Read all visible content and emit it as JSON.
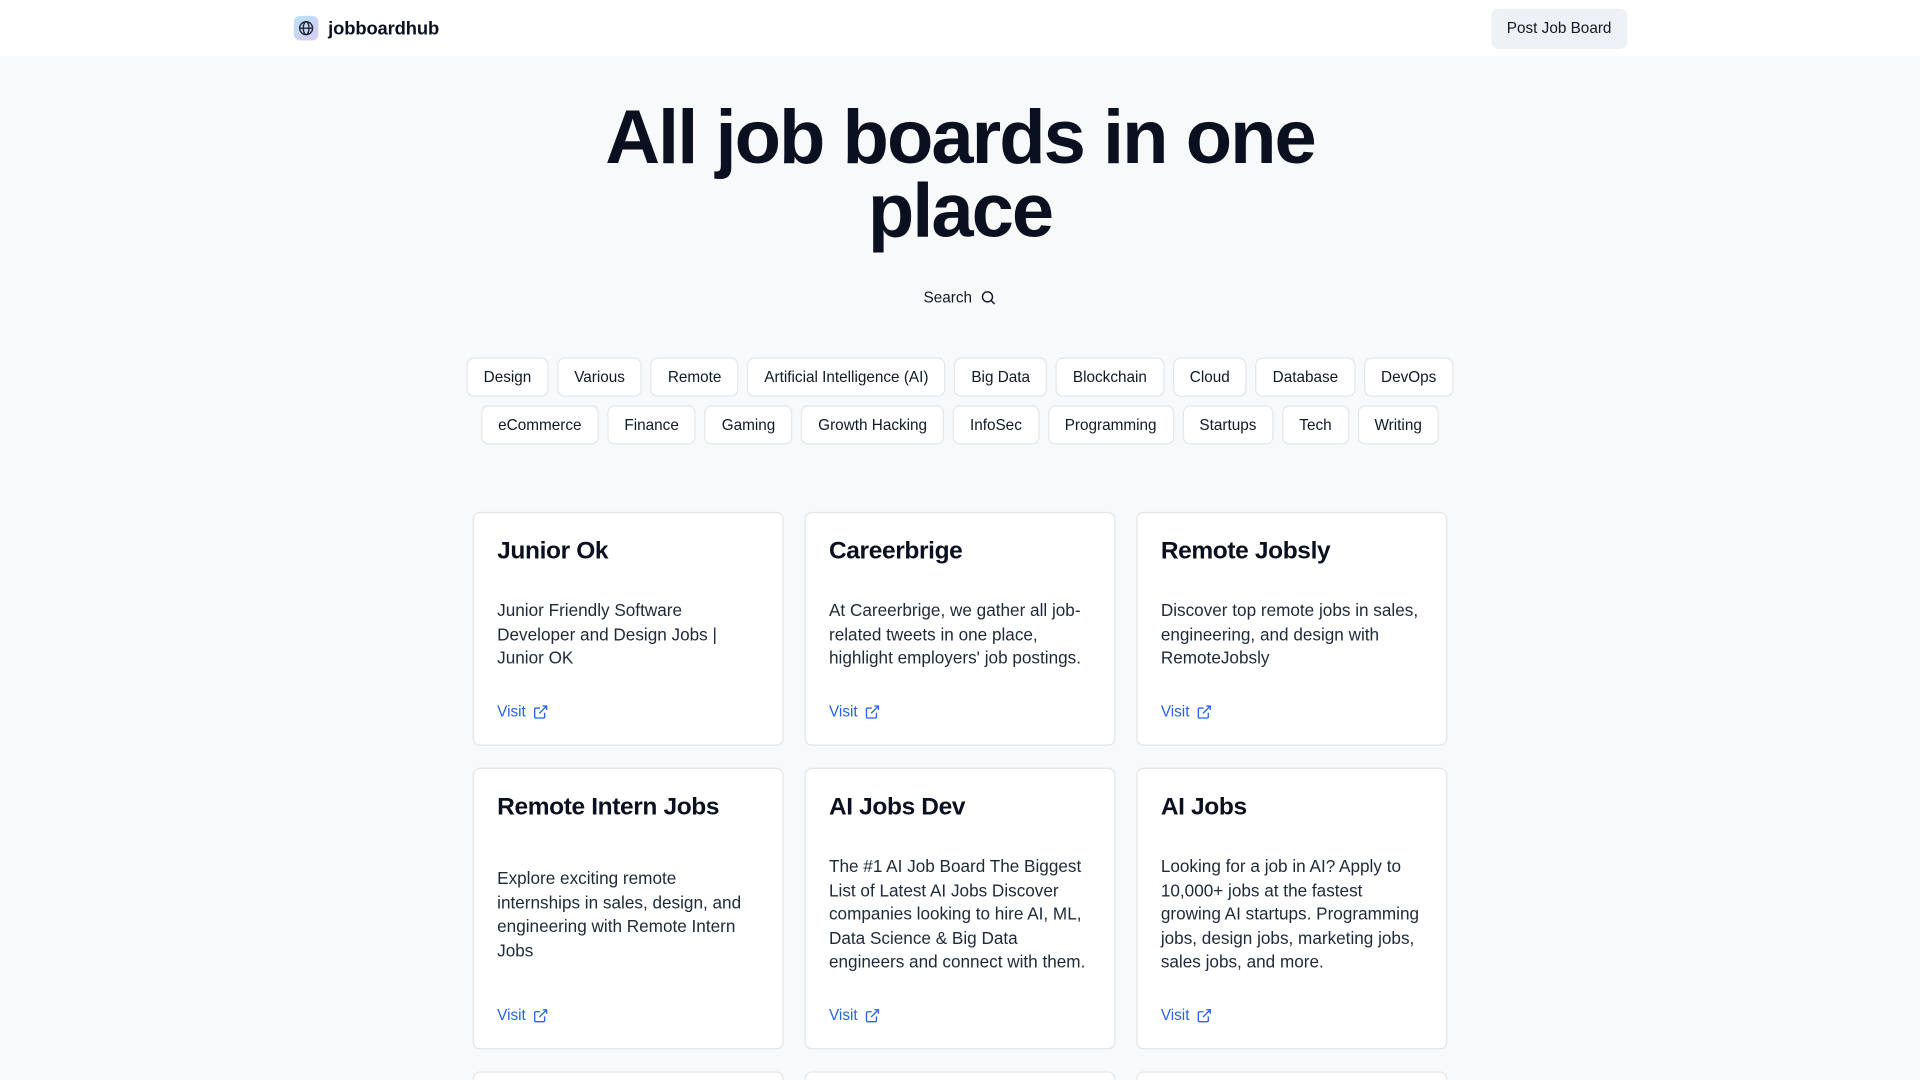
{
  "header": {
    "brand": "jobboardhub",
    "post_button": "Post Job Board"
  },
  "hero": {
    "title": "All job boards in one place",
    "search_label": "Search"
  },
  "tags": {
    "row1": [
      "Design",
      "Various",
      "Remote",
      "Artificial Intelligence (AI)",
      "Big Data",
      "Blockchain",
      "Cloud",
      "Database",
      "DevOps"
    ],
    "row2": [
      "eCommerce",
      "Finance",
      "Gaming",
      "Growth Hacking",
      "InfoSec",
      "Programming",
      "Startups",
      "Tech",
      "Writing"
    ]
  },
  "cards": [
    {
      "title": "Junior Ok",
      "description": "Junior Friendly Software Developer and Design Jobs | Junior OK",
      "link": "Visit"
    },
    {
      "title": "Careerbrige",
      "description": "At Careerbrige, we gather all job-related tweets in one place, highlight employers' job postings.",
      "link": "Visit"
    },
    {
      "title": "Remote Jobsly",
      "description": "Discover top remote jobs in sales, engineering, and design with RemoteJobsly",
      "link": "Visit"
    },
    {
      "title": "Remote Intern Jobs",
      "description": "Explore exciting remote internships in sales, design, and engineering with Remote Intern Jobs",
      "link": "Visit"
    },
    {
      "title": "AI Jobs Dev",
      "description": "The #1 AI Job Board The Biggest List of Latest AI Jobs Discover companies looking to hire AI, ML, Data Science & Big Data engineers and connect with them.",
      "link": "Visit"
    },
    {
      "title": "AI Jobs",
      "description": "Looking for a job in AI? Apply to 10,000+ jobs at the fastest growing AI startups. Programming jobs, design jobs, marketing jobs, sales jobs, and more.",
      "link": "Visit"
    }
  ],
  "colors": {
    "link": "#2563eb",
    "background": "#f8f9fa"
  },
  "icons": {
    "logo": "globe-icon",
    "search": "search-icon",
    "visit": "external-link-icon"
  }
}
